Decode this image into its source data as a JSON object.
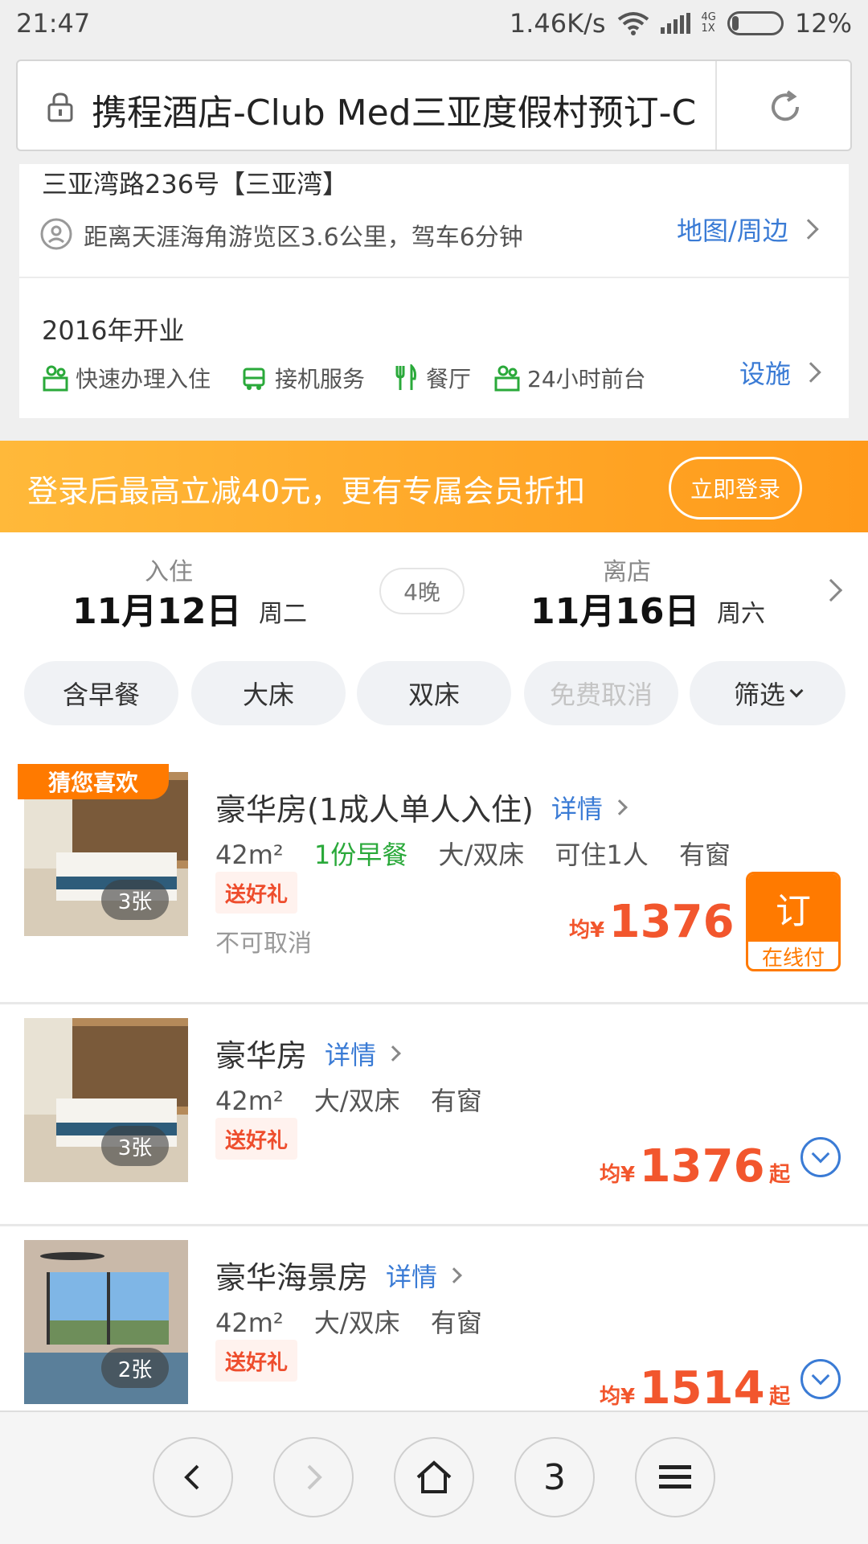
{
  "status_bar": {
    "time": "21:47",
    "network_speed": "1.46K/s",
    "signal_label_top": "4G",
    "signal_label_bottom": "1X",
    "battery": "12%"
  },
  "browser": {
    "url": "携程酒店-Club Med三亚度假村预订-C"
  },
  "hotel_info": {
    "address": "三亚湾路236号【三亚湾】",
    "distance": "距离天涯海角游览区3.6公里，驾车6分钟",
    "map_link": "地图/周边",
    "opened": "2016年开业",
    "facilities": [
      "快速办理入住",
      "接机服务",
      "餐厅",
      "24小时前台"
    ],
    "facilities_link": "设施"
  },
  "promo": {
    "text": "登录后最高立减40元，更有专属会员折扣",
    "button": "立即登录",
    "color": "#ffa21f"
  },
  "dates": {
    "checkin_label": "入住",
    "checkin_date": "11月12日",
    "checkin_weekday": "周二",
    "nights": "4晚",
    "checkout_label": "离店",
    "checkout_date": "11月16日",
    "checkout_weekday": "周六"
  },
  "filters": [
    "含早餐",
    "大床",
    "双床",
    "免费取消",
    "筛选"
  ],
  "rooms": [
    {
      "badge": "猜您喜欢",
      "title": "豪华房(1成人单人入住)",
      "detail": "详情",
      "area": "42m²",
      "breakfast": "1份早餐",
      "bed": "大/双床",
      "occupancy": "可住1人",
      "window": "有窗",
      "gift": "送好礼",
      "cancel": "不可取消",
      "photos": "3张",
      "price_prefix": "均¥",
      "price": "1376",
      "book": "订",
      "pay": "在线付"
    },
    {
      "title": "豪华房",
      "detail": "详情",
      "area": "42m²",
      "bed": "大/双床",
      "window": "有窗",
      "gift": "送好礼",
      "photos": "3张",
      "price_prefix": "均¥",
      "price": "1376",
      "price_suffix": "起"
    },
    {
      "title": "豪华海景房",
      "detail": "详情",
      "area": "42m²",
      "bed": "大/双床",
      "window": "有窗",
      "gift": "送好礼",
      "photos": "2张",
      "price_prefix": "均¥",
      "price": "1514",
      "price_suffix": "起"
    }
  ],
  "bottom_nav": {
    "tabs_count": "3"
  },
  "colors": {
    "accent_blue": "#3a7bd5",
    "price_orange": "#f2562d",
    "promo_orange": "#ffa21f",
    "book_orange": "#ff7a00"
  }
}
